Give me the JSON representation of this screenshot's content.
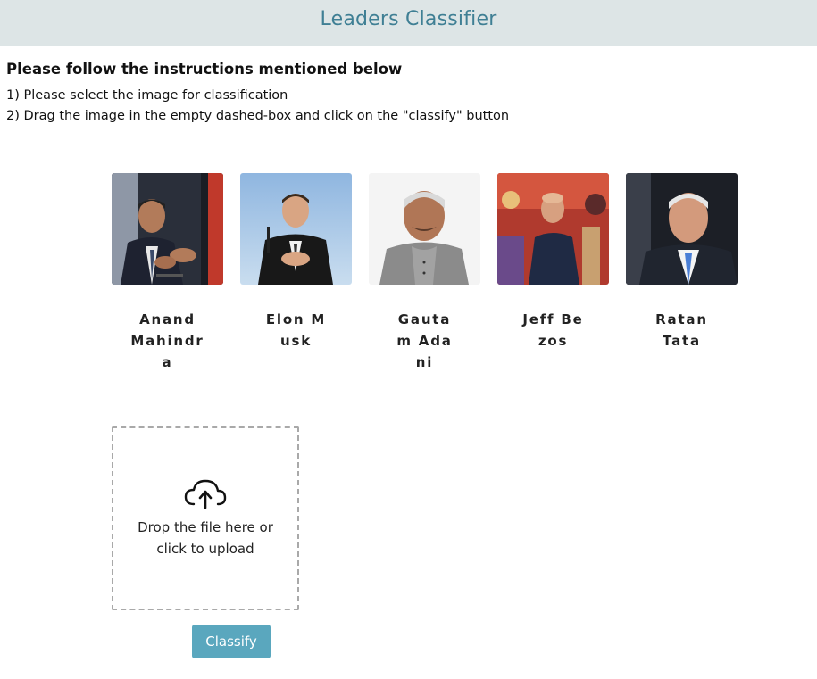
{
  "header": {
    "title": "Leaders Classifier"
  },
  "instructions": {
    "heading": "Please follow the instructions mentioned below",
    "steps": [
      "1) Please select the image for classification",
      "2) Drag the image in the empty dashed-box and click on the \"classify\" button"
    ]
  },
  "leaders": [
    {
      "name": "Anand Mahindra",
      "icon": "anand-mahindra-photo"
    },
    {
      "name": "Elon Musk",
      "icon": "elon-musk-photo"
    },
    {
      "name": "Gautam Adani",
      "icon": "gautam-adani-photo"
    },
    {
      "name": "Jeff Bezos",
      "icon": "jeff-bezos-photo"
    },
    {
      "name": "Ratan Tata",
      "icon": "ratan-tata-photo"
    }
  ],
  "dropzone": {
    "text": "Drop the file here or click to upload",
    "icon": "cloud-upload-icon"
  },
  "actions": {
    "classify_label": "Classify"
  },
  "colors": {
    "header_bg": "#dde5e6",
    "title": "#3f7f94",
    "button": "#5aa7be"
  }
}
